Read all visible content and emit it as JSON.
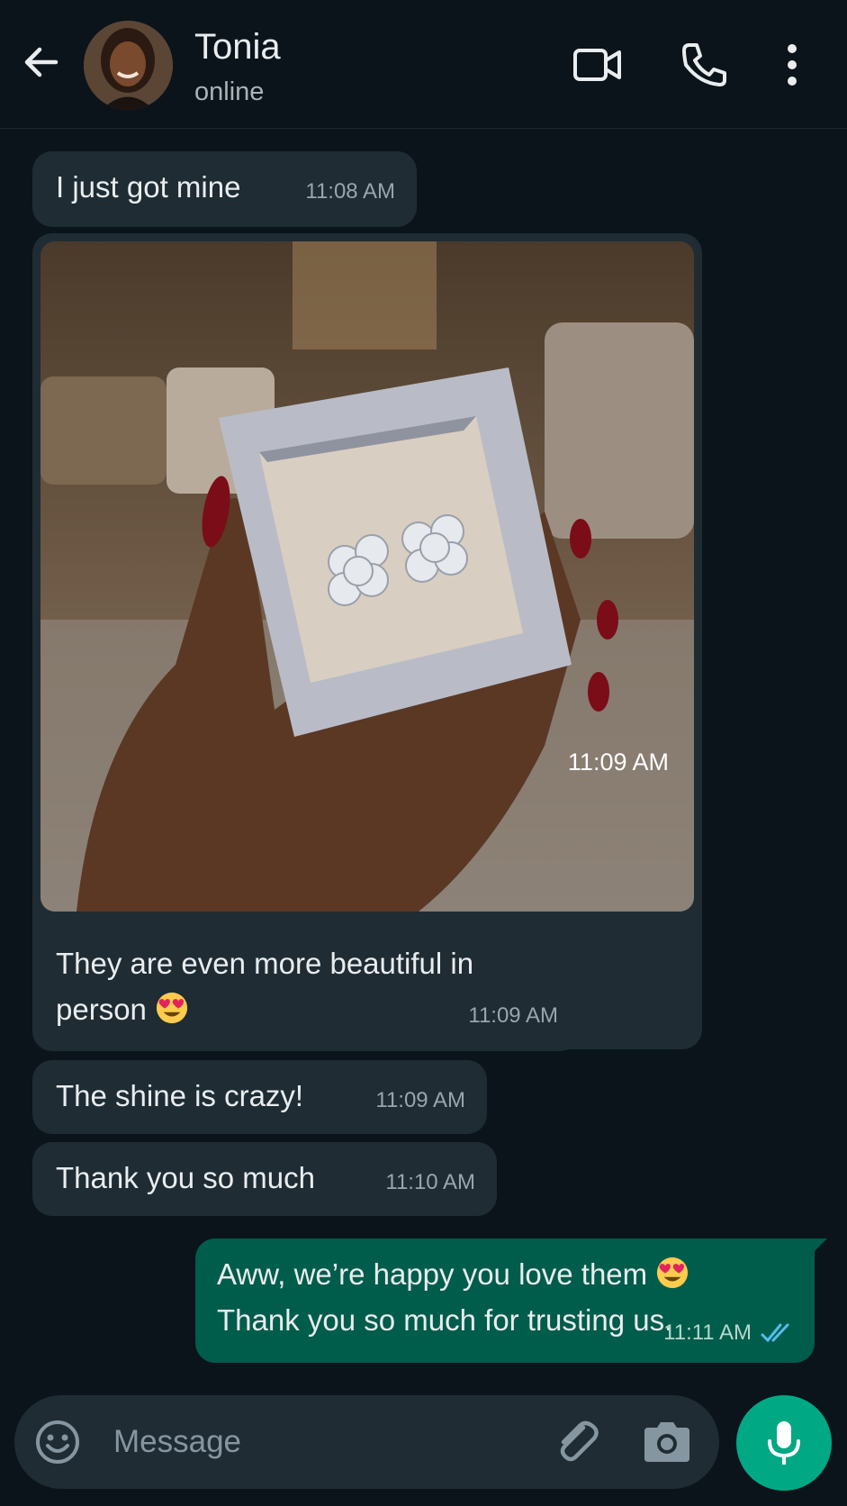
{
  "colors": {
    "background": "#0b141a",
    "incoming_bubble": "#1f2c34",
    "outgoing_bubble": "#005c4b",
    "accent": "#00a884",
    "read_ticks": "#53bdeb"
  },
  "header": {
    "contact_name": "Tonia",
    "status": "online",
    "icons": [
      "back-arrow-icon",
      "video-call-icon",
      "phone-icon",
      "more-vertical-icon"
    ]
  },
  "messages": [
    {
      "direction": "incoming",
      "text": "I just got mine",
      "time": "11:08 AM"
    },
    {
      "direction": "incoming",
      "type": "image",
      "image_description_icon": "photo-earrings-in-box",
      "time": "11:09 AM"
    },
    {
      "direction": "incoming",
      "text_line1": "They are even more beautiful in",
      "text_line2": "person",
      "emoji": "heart-eyes-emoji",
      "time": "11:09 AM"
    },
    {
      "direction": "incoming",
      "text": "The shine is crazy!",
      "time": "11:09 AM"
    },
    {
      "direction": "incoming",
      "text": "Thank you so much",
      "time": "11:10 AM"
    },
    {
      "direction": "outgoing",
      "text_line1": "Aww, we’re happy you love them",
      "text_line2": "Thank you so much for trusting us.",
      "emoji": "heart-eyes-emoji",
      "time": "11:11 AM",
      "status": "read"
    }
  ],
  "input": {
    "placeholder": "Message",
    "value": "",
    "icons": [
      "emoji-icon",
      "attach-icon",
      "camera-icon",
      "microphone-icon"
    ]
  }
}
